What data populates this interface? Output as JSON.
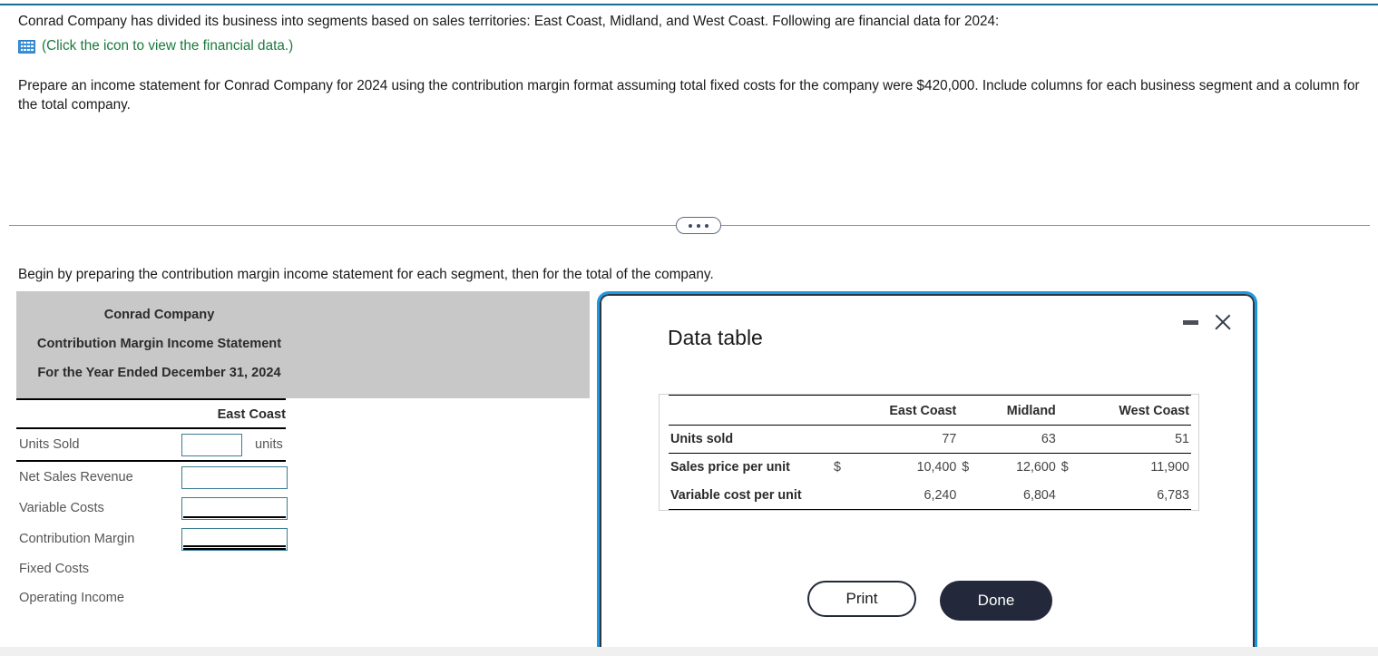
{
  "prompt": {
    "intro": "Conrad Company has divided its business into segments based on sales territories: East Coast, Midland, and West Coast. Following are financial data for 2024:",
    "icon_caption": "(Click the icon to view the financial data.)",
    "icon_name": "spreadsheet-grid-icon",
    "task": "Prepare an income statement for Conrad Company for 2024 using the contribution margin format assuming total fixed costs for the company were $420,000. Include columns for each business segment and a column for the total company."
  },
  "divider": {
    "expand_label": "•••"
  },
  "instruction": "Begin by preparing the contribution margin income statement for each segment, then for the total of the company.",
  "worksheet": {
    "title_line1": "Conrad Company",
    "title_line2": "Contribution Margin Income Statement",
    "title_line3": "For the Year Ended December 31, 2024",
    "column_header": "East Coast",
    "units_suffix": "units",
    "rows": [
      {
        "label": "Units Sold",
        "value": "",
        "placeholder": ""
      },
      {
        "label": "Net Sales Revenue",
        "value": "",
        "placeholder": ""
      },
      {
        "label": "Variable Costs",
        "value": "",
        "placeholder": ""
      },
      {
        "label": "Contribution Margin",
        "value": "",
        "placeholder": ""
      },
      {
        "label": "Fixed Costs",
        "value": "",
        "placeholder": ""
      },
      {
        "label": "Operating Income",
        "value": "",
        "placeholder": ""
      }
    ]
  },
  "dialog": {
    "title": "Data table",
    "minimize_label": "",
    "close_label": "",
    "print_label": "Print",
    "done_label": "Done",
    "table": {
      "col_headers": [
        "East Coast",
        "Midland",
        "West Coast"
      ],
      "rows": [
        {
          "label": "Units sold",
          "currency": [
            "",
            "",
            ""
          ],
          "values": [
            "77",
            "63",
            "51"
          ]
        },
        {
          "label": "Sales price per unit",
          "currency": [
            "$",
            "$",
            "$"
          ],
          "values": [
            "10,400",
            "12,600",
            "11,900"
          ]
        },
        {
          "label": "Variable cost per unit",
          "currency": [
            "",
            "",
            ""
          ],
          "values": [
            "6,240",
            "6,804",
            "6,783"
          ]
        }
      ]
    }
  },
  "colors": {
    "accent_top_rule": "#1b6c94",
    "link_green": "#1a7a3c",
    "dialog_border": "#1b9ae0",
    "dialog_inner_border": "#2f3440",
    "header_gray": "#c8c8c8",
    "done_button": "#23293a",
    "input_border": "#3a7d94"
  }
}
